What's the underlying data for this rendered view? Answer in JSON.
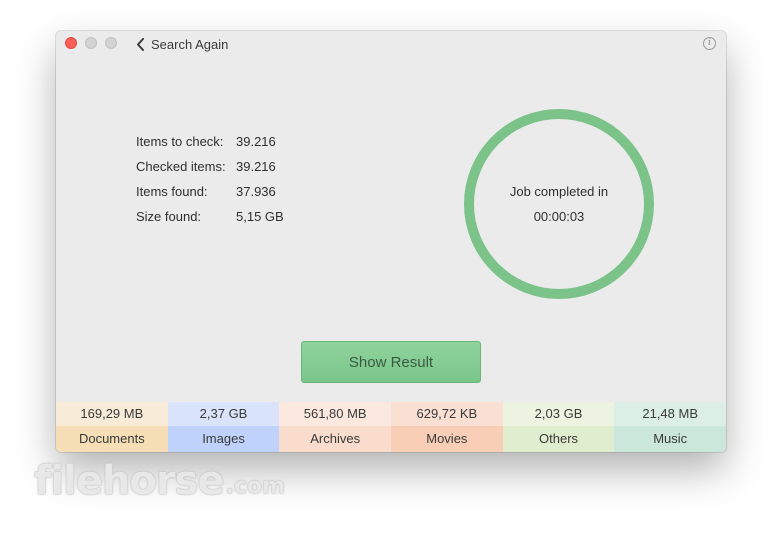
{
  "window": {
    "back_label": "Search Again",
    "info_icon": "info-icon"
  },
  "stats": [
    {
      "label": "Items to check:",
      "value": "39.216"
    },
    {
      "label": "Checked items:",
      "value": "39.216"
    },
    {
      "label": "Items found:",
      "value": "37.936"
    },
    {
      "label": "Size found:",
      "value": "5,15 GB"
    }
  ],
  "status": {
    "line1": "Job completed in",
    "line2": "00:00:03",
    "ring_color": "#7cc38a",
    "progress": 1.0
  },
  "actions": {
    "show_result_label": "Show Result"
  },
  "categories": [
    {
      "name": "Documents",
      "size": "169,29 MB",
      "color_top": "#f8ecd9",
      "color_bottom": "#f6dfb7"
    },
    {
      "name": "Images",
      "size": "2,37 GB",
      "color_top": "#d9e4fb",
      "color_bottom": "#bfd2fb"
    },
    {
      "name": "Archives",
      "size": "561,80 MB",
      "color_top": "#fbe9df",
      "color_bottom": "#f9dccb"
    },
    {
      "name": "Movies",
      "size": "629,72 KB",
      "color_top": "#fae0d3",
      "color_bottom": "#f8cfb6"
    },
    {
      "name": "Others",
      "size": "2,03 GB",
      "color_top": "#ecf3e1",
      "color_bottom": "#e0edcf"
    },
    {
      "name": "Music",
      "size": "21,48 MB",
      "color_top": "#dcefe6",
      "color_bottom": "#cbe6da"
    }
  ],
  "watermark": {
    "text": "filehorse",
    "suffix": ".com"
  }
}
